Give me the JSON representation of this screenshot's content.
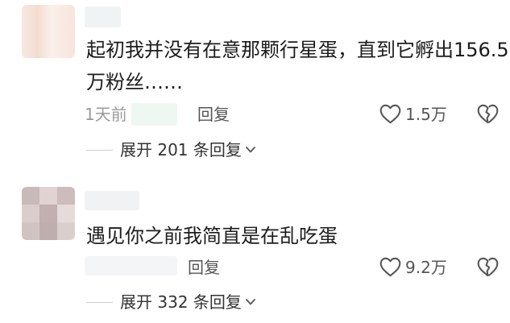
{
  "comments": [
    {
      "text_line1": "起初我并没有在意那颗行星蛋，直到它孵出156.5",
      "text_line2": "万粉丝……",
      "time": "1天前",
      "reply_label": "回复",
      "likes": "1.5万",
      "expand_label": "展开 201 条回复"
    },
    {
      "text_line1": "遇见你之前我简直是在乱吃蛋",
      "reply_label": "回复",
      "likes": "9.2万",
      "expand_label": "展开 332 条回复"
    }
  ],
  "icons": {
    "like": "heart-outline-icon",
    "dislike": "broken-heart-icon",
    "expand": "chevron-down-icon"
  },
  "colors": {
    "text": "#1c1c1c",
    "meta": "#9a9a9a",
    "icon": "#555555"
  }
}
